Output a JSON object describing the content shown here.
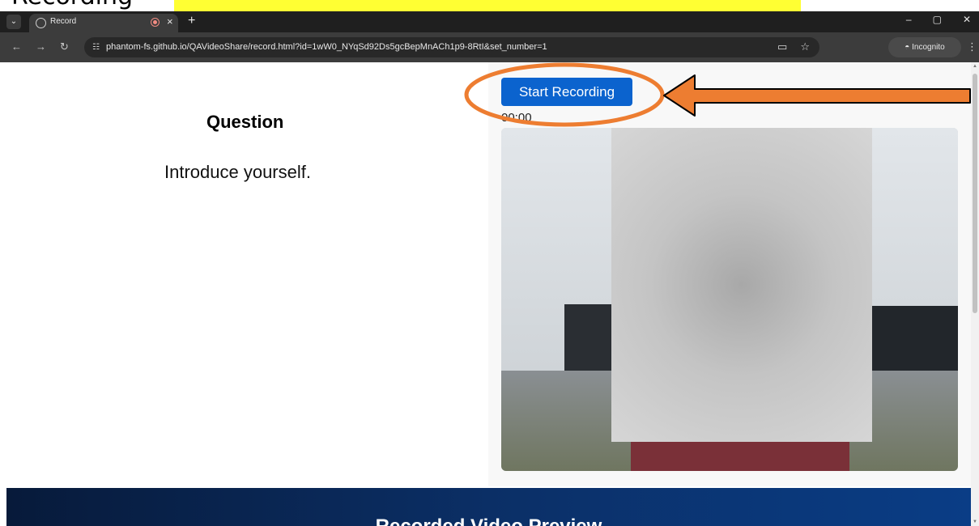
{
  "caption": {
    "text": "Recording"
  },
  "browser": {
    "tab_title": "Record",
    "url": "phantom-fs.github.io/QAVideoShare/record.html?id=1wW0_NYqSd92Ds5gcBepMnACh1p9-8RtI&set_number=1",
    "incognito_label": "Incognito"
  },
  "question": {
    "heading": "Question",
    "text": "Introduce yourself."
  },
  "recorder": {
    "start_label": "Start Recording",
    "timer": "00:00"
  },
  "preview": {
    "title": "Recorded Video Preview"
  },
  "colors": {
    "highlight": "#ffff33",
    "start_button": "#0b63ce",
    "annotation": "#ed7d31",
    "banner": "#0b2f66"
  },
  "icons": {
    "tab_menu": "chevron-down-icon",
    "tab_favicon": "globe-icon",
    "recording_indicator": "record-icon",
    "tab_close": "close-icon",
    "new_tab": "plus-icon",
    "back": "back-arrow-icon",
    "forward": "forward-arrow-icon",
    "reload": "reload-icon",
    "site_info": "tune-icon",
    "camera": "camera-icon",
    "bookmark": "star-icon",
    "incognito": "incognito-icon",
    "menu": "kebab-menu-icon"
  }
}
